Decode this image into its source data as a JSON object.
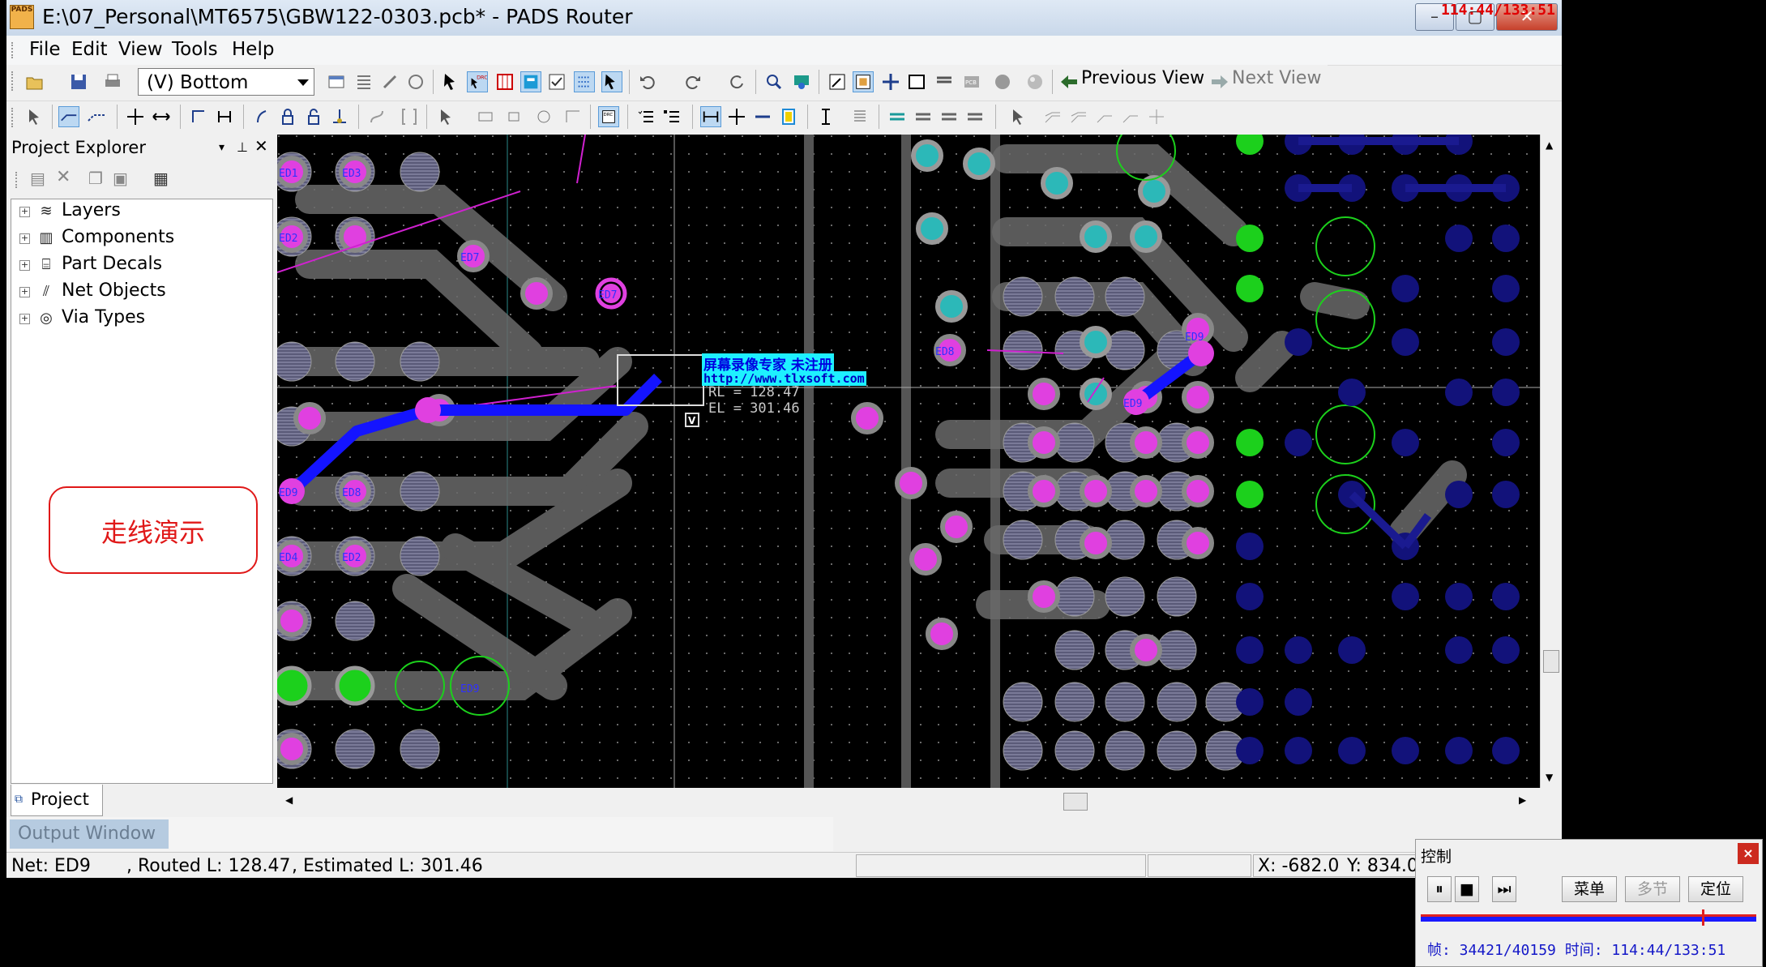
{
  "window": {
    "title": "E:\\07_Personal\\MT6575\\GBW122-0303.pcb* - PADS Router",
    "app_icon_text": "PADS",
    "minimize": "–",
    "maximize": "▢",
    "close": "✕",
    "recorder_overlay": "114:44/133:51"
  },
  "menu": [
    "File",
    "Edit",
    "View",
    "Tools",
    "Help"
  ],
  "toolbar": {
    "layer_select": "(V) Bottom",
    "previous_view": "Previous View",
    "next_view": "Next View"
  },
  "project_explorer": {
    "title": "Project Explorer",
    "tree": [
      {
        "label": "Layers",
        "icon": "layers-icon"
      },
      {
        "label": "Components",
        "icon": "components-icon"
      },
      {
        "label": "Part Decals",
        "icon": "part-decals-icon"
      },
      {
        "label": "Net Objects",
        "icon": "net-objects-icon"
      },
      {
        "label": "Via Types",
        "icon": "via-types-icon"
      }
    ],
    "tab": "Project",
    "annotation": "走线演示"
  },
  "canvas": {
    "tooltip_line1": "屏幕录像专家     未注册",
    "tooltip_line2": "http://www.tlxsoft.com",
    "dim_line1": "RL = 128.47",
    "dim_line2": "EL = 301.46",
    "labels": [
      "ED1",
      "ED3",
      "ED2",
      "ED7",
      "ED7",
      "ED8",
      "ED9",
      "ED8",
      "ED4",
      "ED2",
      "ED9",
      "ED9",
      "ED9"
    ]
  },
  "output_window": {
    "tab": "Output Window"
  },
  "status": {
    "net": "Net: ED9",
    "routed": ", Routed L: 128.47",
    "estimated": ", Estimated L: 301.46",
    "x": "X: -682.0",
    "y": "Y: 834.0"
  },
  "control_panel": {
    "title": "控制",
    "close": "×",
    "menu_button": "菜单",
    "multi_button": "多节",
    "locate_button": "定位",
    "frame_info": "帧: 34421/40159 时间: 114:44/133:51"
  },
  "colors": {
    "pad_magenta": "#e040e0",
    "trace_blue": "#1414ff",
    "pad_green": "#20e020",
    "pad_cyan": "#40c8c8",
    "annotation_red": "#e01818"
  }
}
